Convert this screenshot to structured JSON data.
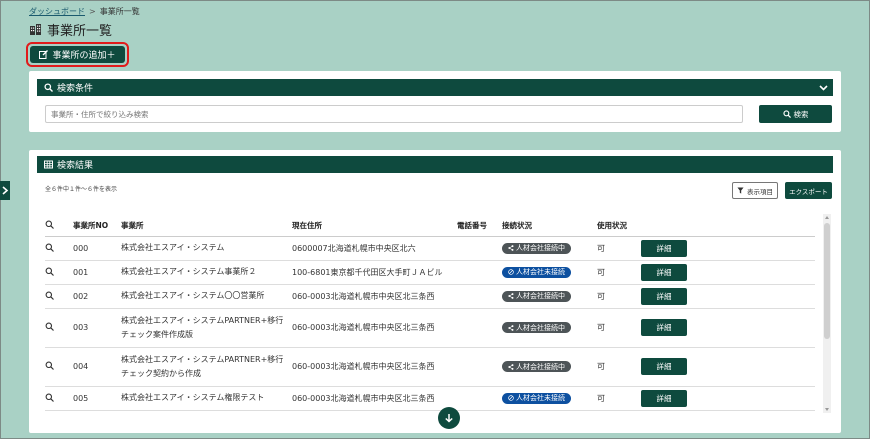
{
  "breadcrumb": {
    "home": "ダッシュボード",
    "separator": ">",
    "current": "事業所一覧"
  },
  "page": {
    "title": "事業所一覧",
    "add_button": "事業所の追加＋"
  },
  "search": {
    "header": "検索条件",
    "placeholder": "事業所・住所で絞り込み検索",
    "button": "検索"
  },
  "results": {
    "header": "検索結果",
    "count_text": "全６件中１件～６件を表示",
    "columns_button": "表示項目",
    "export_button": "エクスポート",
    "columns": {
      "no": "事業所NO",
      "name": "事業所",
      "address": "現在住所",
      "phone": "電話番号",
      "connection": "接続状況",
      "usage": "使用状況"
    },
    "detail_label": "詳細",
    "rows": [
      {
        "no": "000",
        "name": "株式会社エスアイ・システム",
        "address": "0600007北海道札幌市中央区北六",
        "phone": "",
        "status": "人材会社接続中",
        "status_type": "connected",
        "usage": "可"
      },
      {
        "no": "001",
        "name": "株式会社エスアイ・システム事業所２",
        "address": "100-6801東京都千代田区大手町ＪＡビル",
        "phone": "",
        "status": "人材会社未接続",
        "status_type": "disconnected",
        "usage": "可"
      },
      {
        "no": "002",
        "name": "株式会社エスアイ・システム〇〇営業所",
        "address": "060-0003北海道札幌市中央区北三条西",
        "phone": "",
        "status": "人材会社接続中",
        "status_type": "connected",
        "usage": "可"
      },
      {
        "no": "003",
        "name": "株式会社エスアイ・システムPARTNER+移行チェック案件作成版",
        "address": "060-0003北海道札幌市中央区北三条西",
        "phone": "",
        "status": "人材会社接続中",
        "status_type": "connected",
        "usage": "可"
      },
      {
        "no": "004",
        "name": "株式会社エスアイ・システムPARTNER+移行チェック契約から作成",
        "address": "060-0003北海道札幌市中央区北三条西",
        "phone": "",
        "status": "人材会社接続中",
        "status_type": "connected",
        "usage": "可"
      },
      {
        "no": "005",
        "name": "株式会社エスアイ・システム権限テスト",
        "address": "060-0003北海道札幌市中央区北三条西",
        "phone": "",
        "status": "人材会社未接続",
        "status_type": "disconnected",
        "usage": "可"
      }
    ]
  },
  "colors": {
    "primary": "#0e4a3e",
    "background": "#a9d1c5",
    "connected": "#4d5457",
    "disconnected": "#0d50a0",
    "highlight": "#e01b1b"
  }
}
